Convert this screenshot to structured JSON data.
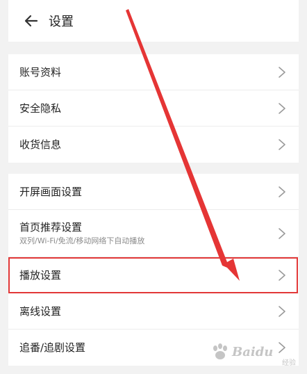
{
  "header": {
    "title": "设置"
  },
  "groups": [
    {
      "items": [
        {
          "label": "账号资料"
        },
        {
          "label": "安全隐私"
        },
        {
          "label": "收货信息"
        }
      ]
    },
    {
      "items": [
        {
          "label": "开屏画面设置"
        },
        {
          "label": "首页推荐设置",
          "sub": "双列/Wi-Fi/免流/移动网络下自动播放"
        },
        {
          "label": "播放设置"
        },
        {
          "label": "离线设置"
        },
        {
          "label": "追番/追剧设置"
        }
      ]
    }
  ],
  "annotation": {
    "highlight_color": "#e23838",
    "highlight_item": "播放设置"
  },
  "watermark": {
    "text": "Baidu",
    "sub": "经验"
  }
}
